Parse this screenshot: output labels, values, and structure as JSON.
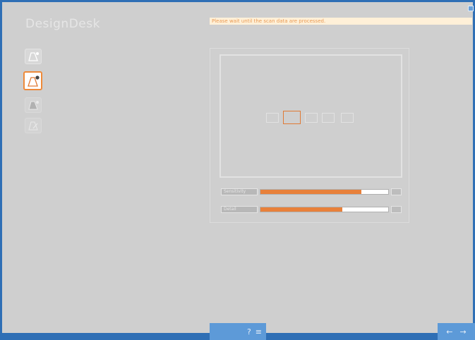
{
  "app": {
    "title": "DesignDesk"
  },
  "notice": {
    "text": "Please wait until the scan data are processed."
  },
  "sidebar": {
    "items": [
      {
        "icon": "bell-shape-add-icon",
        "state": "normal"
      },
      {
        "icon": "bell-shape-dot-icon",
        "state": "active"
      },
      {
        "icon": "bell-shape-grid-icon",
        "state": "disabled"
      },
      {
        "icon": "bell-shape-edit-icon",
        "state": "disabled"
      }
    ]
  },
  "preview": {
    "segments": [
      "1",
      "2",
      "3",
      "4",
      "5"
    ],
    "selected_segment": 2
  },
  "sliders": [
    {
      "label": "Sensitivity",
      "value": 0.79
    },
    {
      "label": "Detail",
      "value": 0.64
    }
  ],
  "toolbar": {
    "help_label": "?",
    "settings_label": "≡"
  },
  "nav": {
    "back_label": "←",
    "next_label": "→"
  },
  "colors": {
    "frame": "#2f6fb5",
    "accent": "#e8803a",
    "background": "#cfcfcf"
  }
}
